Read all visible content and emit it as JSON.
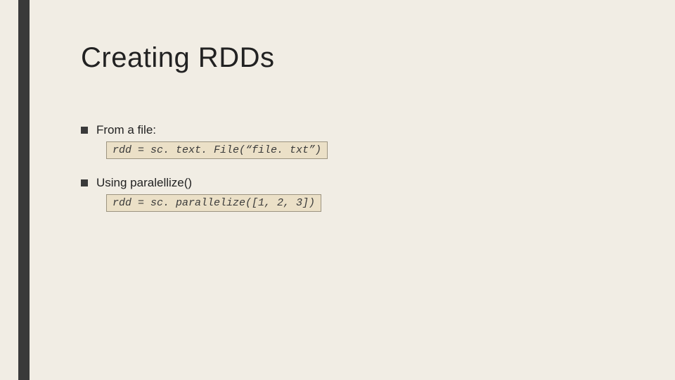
{
  "slide": {
    "title": "Creating RDDs",
    "bullets": [
      {
        "label": "From a file:",
        "code": "rdd = sc. text. File(“file. txt”)"
      },
      {
        "label": "Using paralellize()",
        "code": "rdd = sc. parallelize([1, 2, 3])"
      }
    ]
  }
}
